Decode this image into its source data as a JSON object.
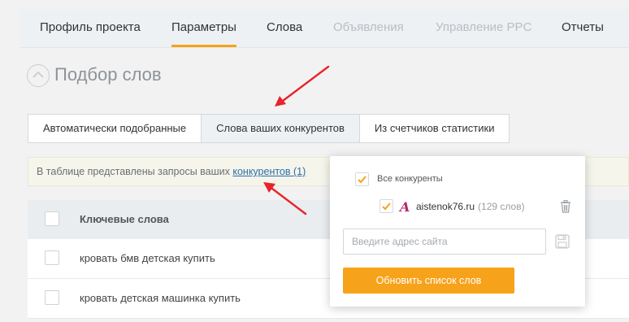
{
  "nav": {
    "items": [
      {
        "label": "Профиль проекта",
        "state": "normal"
      },
      {
        "label": "Параметры",
        "state": "active"
      },
      {
        "label": "Слова",
        "state": "normal"
      },
      {
        "label": "Объявления",
        "state": "disabled"
      },
      {
        "label": "Управление PPC",
        "state": "disabled"
      },
      {
        "label": "Отчеты",
        "state": "normal"
      }
    ]
  },
  "heading": {
    "title": "Подбор слов",
    "icon": "chevron-up-icon"
  },
  "tabs": [
    {
      "label": "Автоматически подобранные",
      "active": false
    },
    {
      "label": "Слова ваших конкурентов",
      "active": true
    },
    {
      "label": "Из счетчиков статистики",
      "active": false
    }
  ],
  "infobar": {
    "text": "В таблице представлены запросы ваших ",
    "link": "конкурентов (1)"
  },
  "table": {
    "header": "Ключевые слова",
    "rows": [
      {
        "keyword": "кровать бмв детская купить"
      },
      {
        "keyword": "кровать детская машинка купить"
      }
    ]
  },
  "popup": {
    "all_competitors_label": "Все конкуренты",
    "all_checked": true,
    "site": {
      "logo_letter": "A",
      "name": "aistenok76.ru",
      "count": "(129 слов)",
      "checked": true
    },
    "input_placeholder": "Введите адрес сайта",
    "update_button": "Обновить список слов"
  },
  "colors": {
    "accent": "#f7a21b",
    "link": "#2e6fa8",
    "annotation_arrow": "#e8232a"
  }
}
